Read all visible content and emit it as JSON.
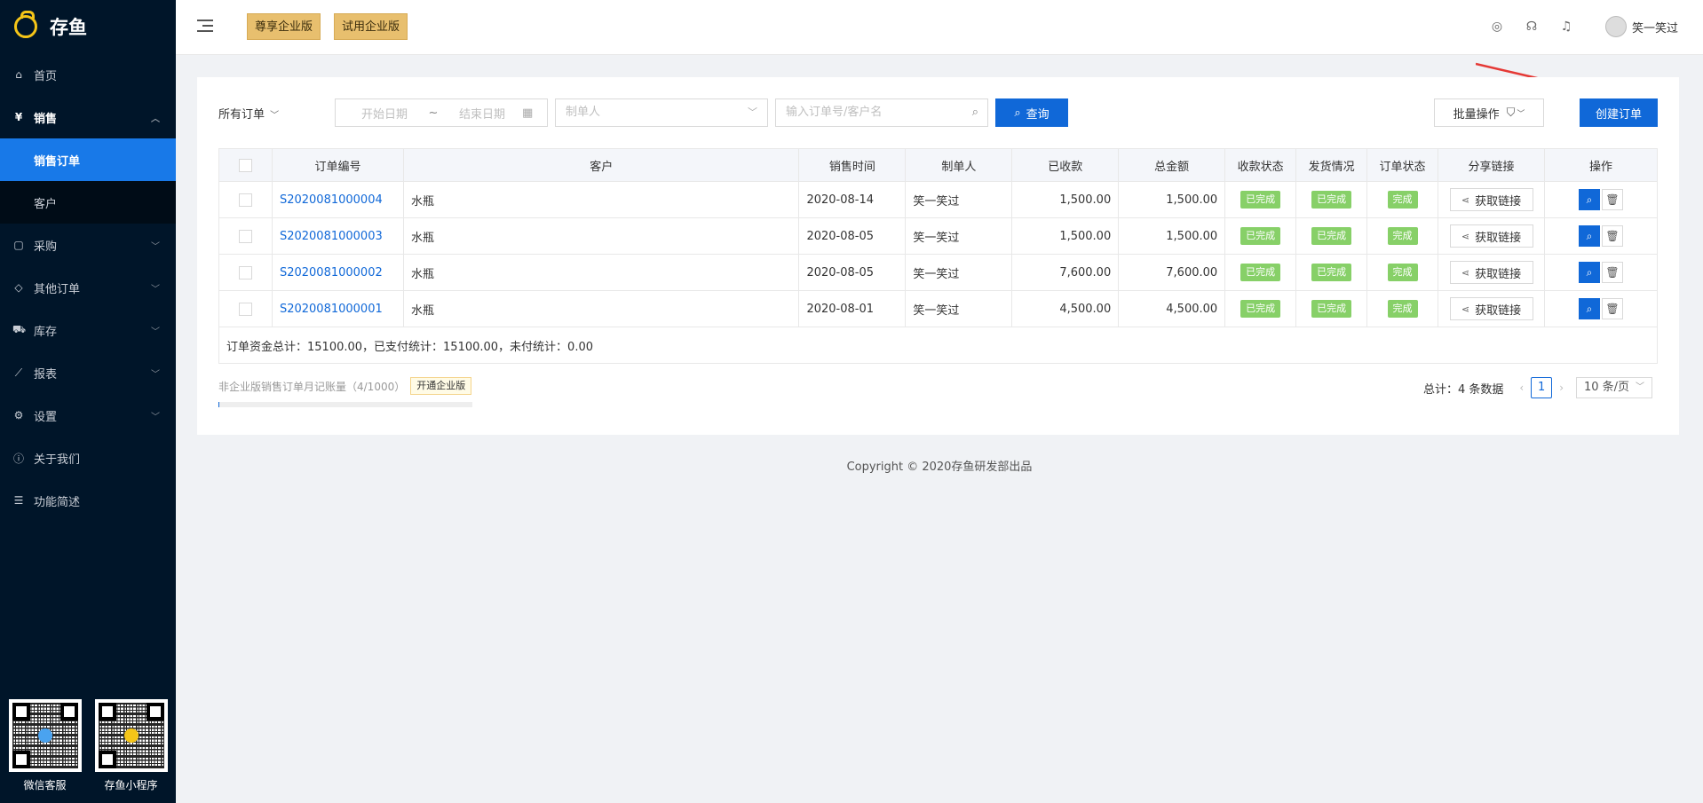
{
  "app": {
    "name": "存鱼"
  },
  "sidebar": {
    "items": [
      {
        "label": "首页",
        "icon": "home-icon"
      },
      {
        "label": "销售",
        "icon": "yen-icon",
        "open": true
      },
      {
        "label": "采购",
        "icon": "bag-icon"
      },
      {
        "label": "其他订单",
        "icon": "tag-icon"
      },
      {
        "label": "库存",
        "icon": "cart-icon"
      },
      {
        "label": "报表",
        "icon": "chart-icon"
      },
      {
        "label": "设置",
        "icon": "gear-icon"
      },
      {
        "label": "关于我们",
        "icon": "info-icon"
      },
      {
        "label": "功能简述",
        "icon": "list-icon"
      }
    ],
    "sales_sub": [
      "销售订单",
      "客户"
    ],
    "qr": [
      {
        "label": "微信客服",
        "center_color": "#4aa3f0"
      },
      {
        "label": "存鱼小程序",
        "center_color": "#f5c518"
      }
    ]
  },
  "header": {
    "edition_premium": "尊享企业版",
    "edition_trial": "试用企业版",
    "user_name": "笑一笑过"
  },
  "filter": {
    "order_type": "所有订单",
    "start_placeholder": "开始日期",
    "range_sep": "~",
    "end_placeholder": "结束日期",
    "maker_placeholder": "制单人",
    "search_placeholder": "输入订单号/客户名",
    "query_label": "查询",
    "batch_label": "批量操作",
    "create_label": "创建订单"
  },
  "table": {
    "columns": [
      "订单编号",
      "客户",
      "销售时间",
      "制单人",
      "已收款",
      "总金额",
      "收款状态",
      "发货情况",
      "订单状态",
      "分享链接",
      "操作"
    ],
    "rows": [
      {
        "order_no": "S2020081000004",
        "customer": "水瓶",
        "date": "2020-08-14",
        "maker": "笑一笑过",
        "received": "1,500.00",
        "total": "1,500.00",
        "pay_status": "已完成",
        "ship_status": "已完成",
        "order_status": "完成",
        "share": "获取链接"
      },
      {
        "order_no": "S2020081000003",
        "customer": "水瓶",
        "date": "2020-08-05",
        "maker": "笑一笑过",
        "received": "1,500.00",
        "total": "1,500.00",
        "pay_status": "已完成",
        "ship_status": "已完成",
        "order_status": "完成",
        "share": "获取链接"
      },
      {
        "order_no": "S2020081000002",
        "customer": "水瓶",
        "date": "2020-08-05",
        "maker": "笑一笑过",
        "received": "7,600.00",
        "total": "7,600.00",
        "pay_status": "已完成",
        "ship_status": "已完成",
        "order_status": "完成",
        "share": "获取链接"
      },
      {
        "order_no": "S2020081000001",
        "customer": "水瓶",
        "date": "2020-08-01",
        "maker": "笑一笑过",
        "received": "4,500.00",
        "total": "4,500.00",
        "pay_status": "已完成",
        "ship_status": "已完成",
        "order_status": "完成",
        "share": "获取链接"
      }
    ],
    "summary": "订单资金总计：15100.00，已支付统计：15100.00，未付统计：0.00"
  },
  "usage": {
    "text": "非企业版销售订单月记账量（4/1000）",
    "fraction": 0.004,
    "upgrade_label": "开通企业版"
  },
  "pager": {
    "total_text": "总计：4 条数据",
    "current": "1",
    "page_size": "10 条/页"
  },
  "footer": {
    "text": "Copyright © 2020存鱼研发部出品"
  },
  "colors": {
    "accent": "#1068d8",
    "sidebar": "#001529",
    "tag_green": "#87d068",
    "edition_gold": "#e8bf6e",
    "annotation_arrow": "#e53935"
  }
}
